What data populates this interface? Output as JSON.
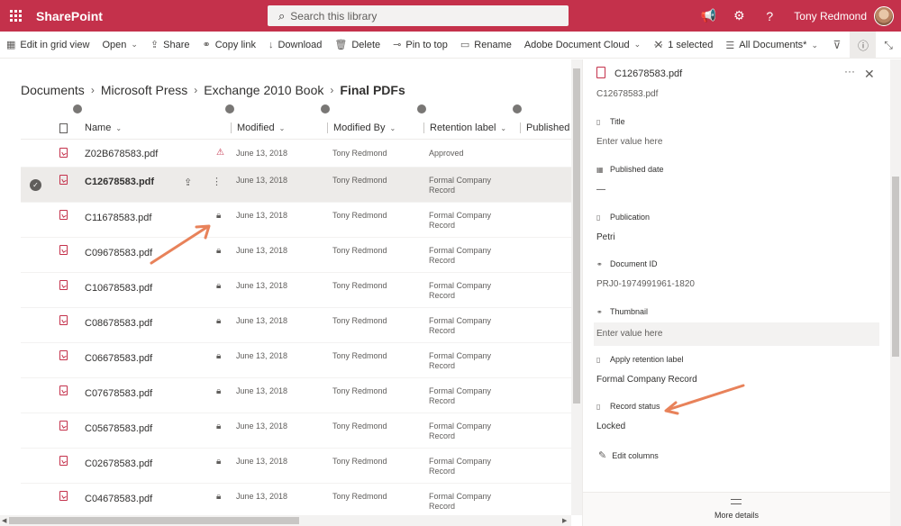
{
  "suitebar": {
    "app_name": "SharePoint",
    "search_placeholder": "Search this library",
    "user_name": "Tony Redmond",
    "icons": [
      "app-launcher-icon",
      "megaphone-icon",
      "gear-icon",
      "help-icon"
    ],
    "color": "#c4314b"
  },
  "commandbar": {
    "edit_grid": "Edit in grid view",
    "open": "Open",
    "share": "Share",
    "copy_link": "Copy link",
    "download": "Download",
    "delete": "Delete",
    "pin_to_top": "Pin to top",
    "rename": "Rename",
    "adobe": "Adobe Document Cloud",
    "more": "···",
    "selected": "1 selected",
    "view": "All Documents*"
  },
  "breadcrumb": [
    "Documents",
    "Microsoft Press",
    "Exchange 2010 Book",
    "Final PDFs"
  ],
  "columns": {
    "name": "Name",
    "modified": "Modified",
    "modified_by": "Modified By",
    "retention": "Retention label",
    "published": "Published d"
  },
  "files": [
    {
      "name": "Z02B678583.pdf",
      "status": "warning",
      "modified": "June 13, 2018",
      "modified_by": "Tony Redmond",
      "retention": "Approved"
    },
    {
      "name": "C12678583.pdf",
      "status": "selected",
      "modified": "June 13, 2018",
      "modified_by": "Tony Redmond",
      "retention": "Formal Company Record"
    },
    {
      "name": "C11678583.pdf",
      "status": "locked",
      "modified": "June 13, 2018",
      "modified_by": "Tony Redmond",
      "retention": "Formal Company Record"
    },
    {
      "name": "C09678583.pdf",
      "status": "locked",
      "modified": "June 13, 2018",
      "modified_by": "Tony Redmond",
      "retention": "Formal Company Record"
    },
    {
      "name": "C10678583.pdf",
      "status": "locked",
      "modified": "June 13, 2018",
      "modified_by": "Tony Redmond",
      "retention": "Formal Company Record"
    },
    {
      "name": "C08678583.pdf",
      "status": "locked",
      "modified": "June 13, 2018",
      "modified_by": "Tony Redmond",
      "retention": "Formal Company Record"
    },
    {
      "name": "C06678583.pdf",
      "status": "locked",
      "modified": "June 13, 2018",
      "modified_by": "Tony Redmond",
      "retention": "Formal Company Record"
    },
    {
      "name": "C07678583.pdf",
      "status": "locked",
      "modified": "June 13, 2018",
      "modified_by": "Tony Redmond",
      "retention": "Formal Company Record"
    },
    {
      "name": "C05678583.pdf",
      "status": "locked",
      "modified": "June 13, 2018",
      "modified_by": "Tony Redmond",
      "retention": "Formal Company Record"
    },
    {
      "name": "C02678583.pdf",
      "status": "locked",
      "modified": "June 13, 2018",
      "modified_by": "Tony Redmond",
      "retention": "Formal Company Record"
    },
    {
      "name": "C04678583.pdf",
      "status": "locked",
      "modified": "June 13, 2018",
      "modified_by": "Tony Redmond",
      "retention": "Formal Company Record"
    }
  ],
  "pane": {
    "title": "C12678583.pdf",
    "filename": "C12678583.pdf",
    "props": {
      "title_label": "Title",
      "title_value": "Enter value here",
      "published_label": "Published date",
      "published_value": "—",
      "publication_label": "Publication",
      "publication_value": "Petri",
      "docid_label": "Document ID",
      "docid_value": "PRJ0-1974991961-1820",
      "thumb_label": "Thumbnail",
      "thumb_value": "Enter value here",
      "retention_label": "Apply retention label",
      "retention_value": "Formal Company Record",
      "record_label": "Record status",
      "record_value": "Locked"
    },
    "edit_columns": "Edit columns",
    "more_details": "More details"
  },
  "annotation_color": "#e8825a"
}
